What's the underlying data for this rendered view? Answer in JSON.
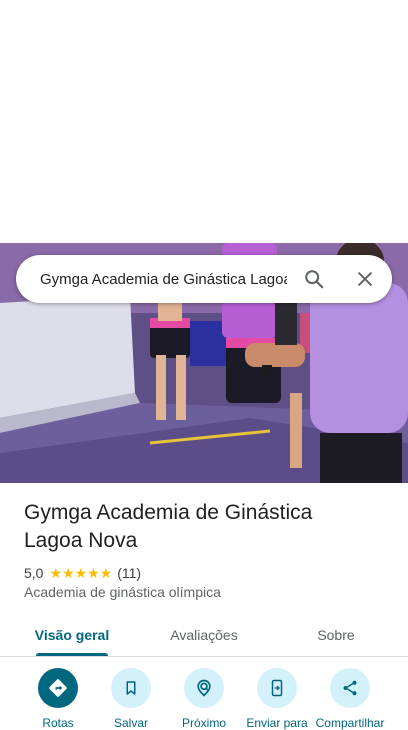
{
  "search": {
    "value": "Gymga Academia de Ginástica Lagoa Nova"
  },
  "place": {
    "name": "Gymga Academia de Ginástica Lagoa Nova",
    "rating": "5,0",
    "stars": "★★★★★",
    "review_count": "(11)",
    "category": "Academia de ginástica olímpica"
  },
  "tabs": [
    {
      "label": "Visão geral",
      "active": true
    },
    {
      "label": "Avaliações",
      "active": false
    },
    {
      "label": "Sobre",
      "active": false
    }
  ],
  "actions": [
    {
      "label": "Rotas",
      "icon": "directions-icon"
    },
    {
      "label": "Salvar",
      "icon": "bookmark-icon"
    },
    {
      "label": "Próximo",
      "icon": "nearby-icon"
    },
    {
      "label": "Enviar para",
      "icon": "send-to-phone-icon"
    },
    {
      "label": "Compartilhar",
      "icon": "share-icon"
    }
  ],
  "colors": {
    "accent": "#00677f",
    "action_bg": "#d2f1fb",
    "star": "#fbbc04"
  }
}
